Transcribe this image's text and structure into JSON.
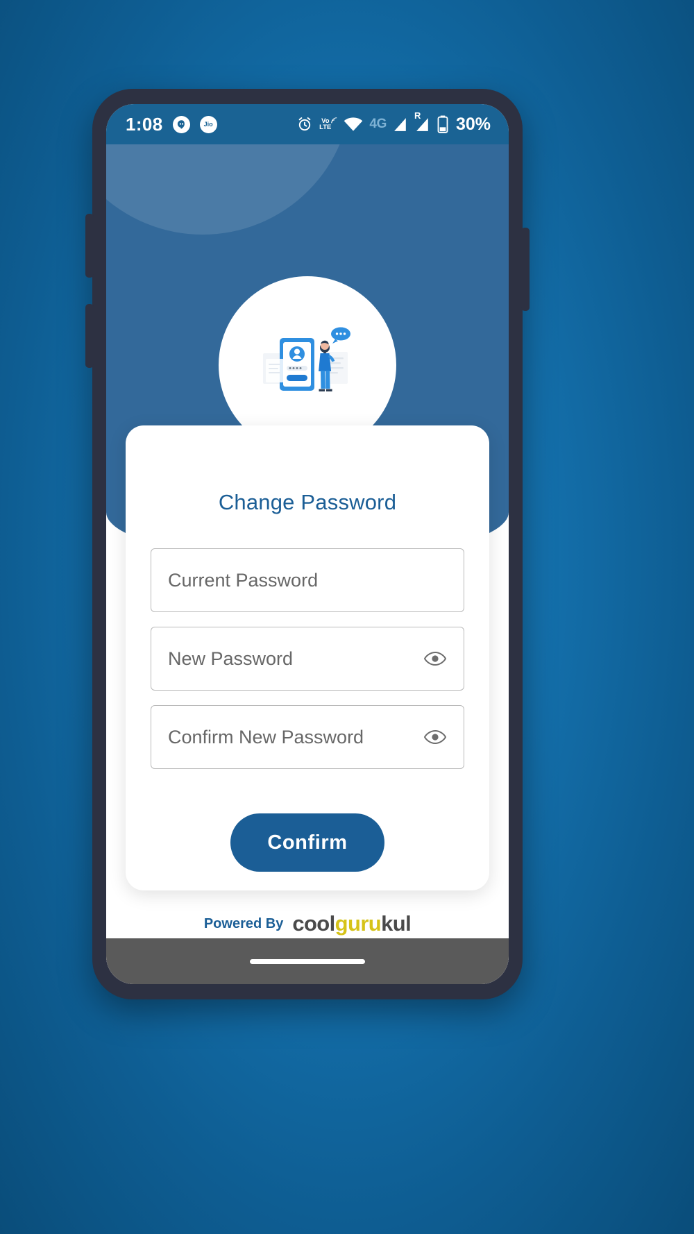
{
  "status_bar": {
    "time": "1:08",
    "notification_icons": [
      {
        "name": "hangouts-icon",
        "glyph": "\""
      },
      {
        "name": "jio-icon",
        "glyph": "Jio"
      }
    ],
    "alarm_icon": "alarm-icon",
    "volte_line1": "Vo",
    "volte_line2": "LTE",
    "wifi_icon": "wifi-icon",
    "network_type": "4G",
    "signal_icon_1": "signal-bars-icon",
    "roaming_label": "R",
    "signal_icon_2": "signal-bars-roaming-icon",
    "battery_icon": "battery-icon",
    "battery_level": "30%"
  },
  "screen": {
    "title": "Change Password",
    "illustration": "login-security-illustration",
    "fields": [
      {
        "id": "current-password",
        "placeholder": "Current Password",
        "value": "",
        "has_toggle": false,
        "toggle_icon": ""
      },
      {
        "id": "new-password",
        "placeholder": "New Password",
        "value": "",
        "has_toggle": true,
        "toggle_icon": "eye-icon"
      },
      {
        "id": "confirm-password",
        "placeholder": "Confirm New Password",
        "value": "",
        "has_toggle": true,
        "toggle_icon": "eye-icon"
      }
    ],
    "submit_label": "Confirm",
    "footer": {
      "powered_by": "Powered By",
      "brand_part1": "cool",
      "brand_part2": "guru",
      "brand_part3": "kul"
    }
  },
  "colors": {
    "accent_blue": "#1b5e96",
    "status_bar_blue": "#1a6394",
    "backdrop_blue": "#33699a",
    "brand_gold": "#d6c319",
    "brand_dark": "#4a4a4a",
    "placeholder_gray": "#676767",
    "page_background": "#1573b0"
  }
}
